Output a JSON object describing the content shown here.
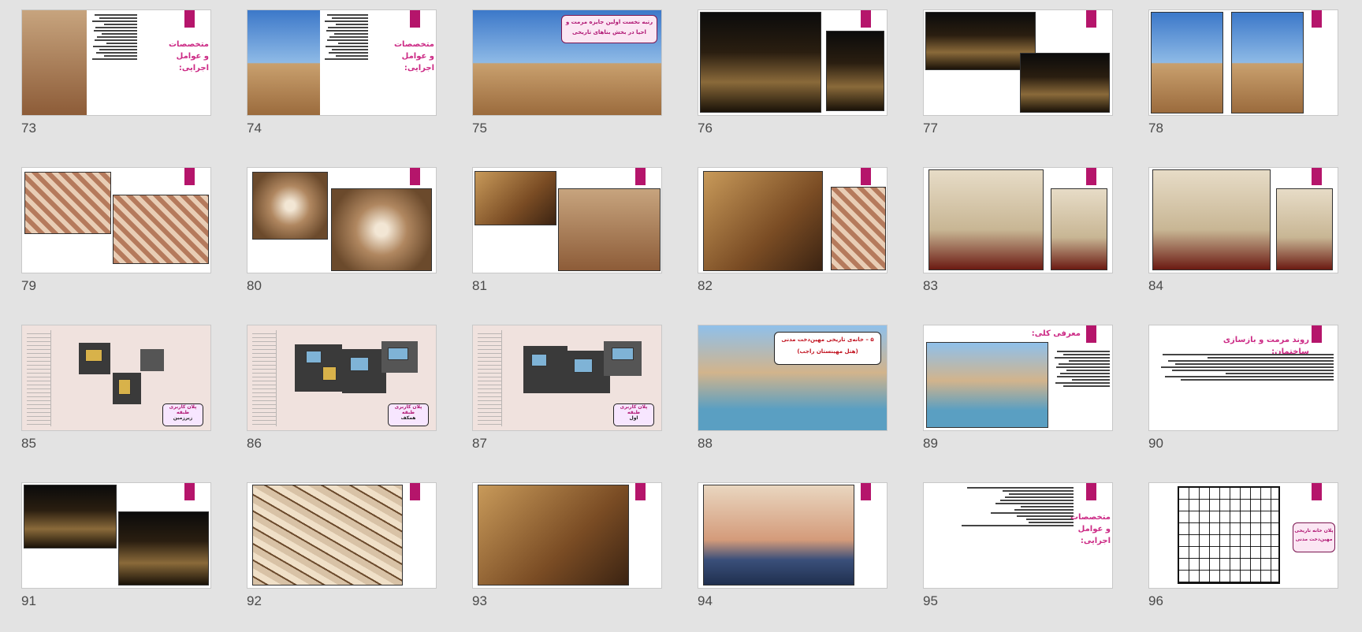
{
  "slides": [
    {
      "num": "73",
      "title": "متخصصات و عوامل اجرایی:"
    },
    {
      "num": "74",
      "title": "متخصصات و عوامل اجرایی:"
    },
    {
      "num": "75",
      "caption": "رتبه نخست اولین جایزه مرمت و احیا در بخش بناهای تاریخی"
    },
    {
      "num": "76"
    },
    {
      "num": "77"
    },
    {
      "num": "78"
    },
    {
      "num": "79"
    },
    {
      "num": "80"
    },
    {
      "num": "81"
    },
    {
      "num": "82"
    },
    {
      "num": "83"
    },
    {
      "num": "84"
    },
    {
      "num": "85",
      "plan_title": "پلان کاربری طبقه",
      "plan_sub": "زیرزمین"
    },
    {
      "num": "86",
      "plan_title": "پلان کاربری طبقه",
      "plan_sub": "همکف"
    },
    {
      "num": "87",
      "plan_title": "پلان کاربری طبقه",
      "plan_sub": "اول"
    },
    {
      "num": "88",
      "caption_l1": "۵ – خانه‌ی تاریخی مهین‌دخت مدنی",
      "caption_l2": "(هتل مهینستان راجب)"
    },
    {
      "num": "89",
      "title": "معرفی کلی:"
    },
    {
      "num": "90",
      "title": "روند مرمت و بازسازی ساختمان:"
    },
    {
      "num": "91"
    },
    {
      "num": "92"
    },
    {
      "num": "93"
    },
    {
      "num": "94"
    },
    {
      "num": "95",
      "title": "متخصصات و عوامل اجرایی:"
    },
    {
      "num": "96",
      "caption": "پلان خانه تاریخی مهین‌دخت مدنی"
    }
  ],
  "colors": {
    "accent": "#b5156b",
    "title_pink": "#cc2a85",
    "background": "#e3e3e3"
  }
}
